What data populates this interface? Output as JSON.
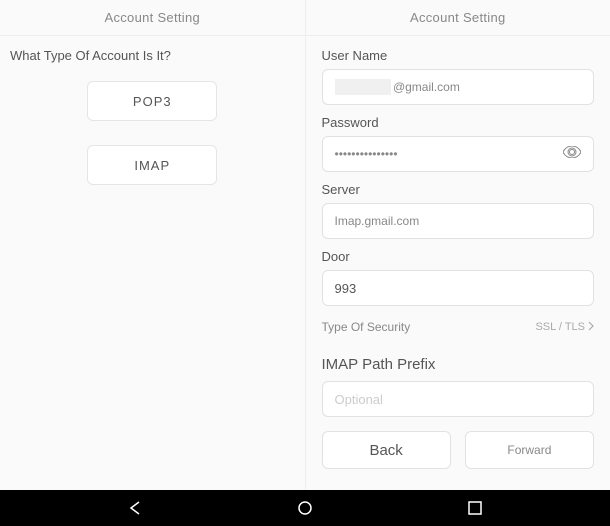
{
  "left": {
    "header": "Account Setting",
    "question": "What Type Of Account Is It?",
    "pop3_label": "POP3",
    "imap_label": "IMAP"
  },
  "right": {
    "header": "Account Setting",
    "username_label": "User Name",
    "username_value": "@gmail.com",
    "password_label": "Password",
    "password_value": "•••••••••••••••",
    "server_label": "Server",
    "server_value": "Imap.gmail.com",
    "door_label": "Door",
    "door_value": "993",
    "security_label": "Type Of Security",
    "security_value": "SSL / TLS",
    "prefix_label": "IMAP Path Prefix",
    "prefix_placeholder": "Optional",
    "back_label": "Back",
    "forward_label": "Forward"
  }
}
